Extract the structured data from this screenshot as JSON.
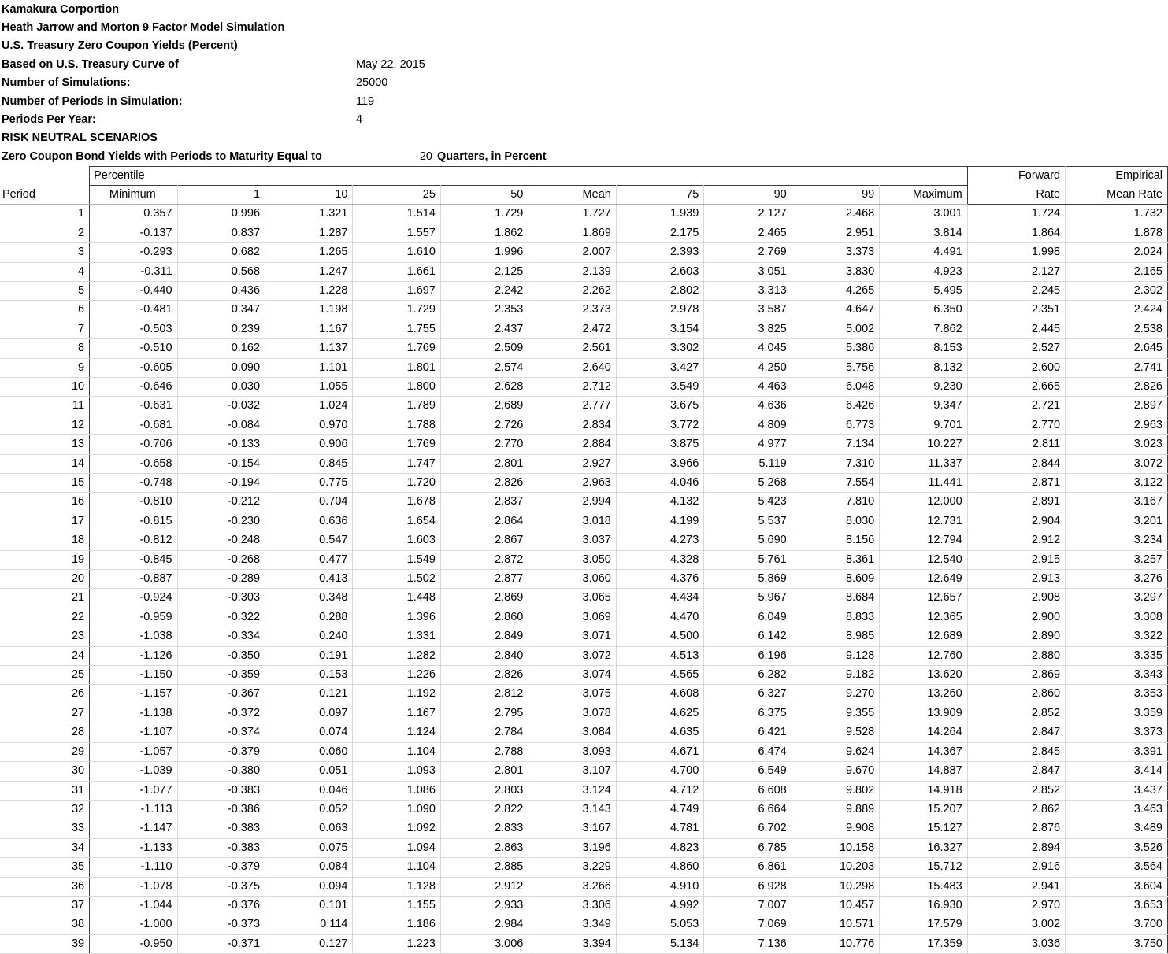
{
  "header": {
    "company": "Kamakura Corportion",
    "model": "Heath Jarrow and Morton 9 Factor Model Simulation",
    "subject": "U.S. Treasury Zero Coupon Yields (Percent)",
    "rows": [
      {
        "label": "Based on U.S. Treasury Curve of",
        "value": "May 22, 2015"
      },
      {
        "label": "Number of Simulations:",
        "value": "25000"
      },
      {
        "label": "Number of Periods in Simulation:",
        "value": "119"
      },
      {
        "label": "Periods Per Year:",
        "value": "4"
      }
    ],
    "scenario_label": "RISK NEUTRAL SCENARIOS",
    "maturity_label": "Zero Coupon Bond Yields with Periods to Maturity Equal to",
    "maturity_value": "20",
    "maturity_unit": "Quarters, in Percent"
  },
  "table": {
    "group_header": "Percentile",
    "period_header": "Period",
    "forward_line1": "Forward",
    "forward_line2": "Rate",
    "empirical_line1": "Empirical",
    "empirical_line2": "Mean Rate",
    "columns": [
      "Minimum",
      "1",
      "10",
      "25",
      "50",
      "Mean",
      "75",
      "90",
      "99",
      "Maximum"
    ],
    "rows": [
      [
        "1",
        "0.357",
        "0.996",
        "1.321",
        "1.514",
        "1.729",
        "1.727",
        "1.939",
        "2.127",
        "2.468",
        "3.001",
        "1.724",
        "1.732"
      ],
      [
        "2",
        "-0.137",
        "0.837",
        "1.287",
        "1.557",
        "1.862",
        "1.869",
        "2.175",
        "2.465",
        "2.951",
        "3.814",
        "1.864",
        "1.878"
      ],
      [
        "3",
        "-0.293",
        "0.682",
        "1.265",
        "1.610",
        "1.996",
        "2.007",
        "2.393",
        "2.769",
        "3.373",
        "4.491",
        "1.998",
        "2.024"
      ],
      [
        "4",
        "-0.311",
        "0.568",
        "1.247",
        "1.661",
        "2.125",
        "2.139",
        "2.603",
        "3.051",
        "3.830",
        "4.923",
        "2.127",
        "2.165"
      ],
      [
        "5",
        "-0.440",
        "0.436",
        "1.228",
        "1.697",
        "2.242",
        "2.262",
        "2.802",
        "3.313",
        "4.265",
        "5.495",
        "2.245",
        "2.302"
      ],
      [
        "6",
        "-0.481",
        "0.347",
        "1.198",
        "1.729",
        "2.353",
        "2.373",
        "2.978",
        "3.587",
        "4.647",
        "6.350",
        "2.351",
        "2.424"
      ],
      [
        "7",
        "-0.503",
        "0.239",
        "1.167",
        "1.755",
        "2.437",
        "2.472",
        "3.154",
        "3.825",
        "5.002",
        "7.862",
        "2.445",
        "2.538"
      ],
      [
        "8",
        "-0.510",
        "0.162",
        "1.137",
        "1.769",
        "2.509",
        "2.561",
        "3.302",
        "4.045",
        "5.386",
        "8.153",
        "2.527",
        "2.645"
      ],
      [
        "9",
        "-0.605",
        "0.090",
        "1.101",
        "1.801",
        "2.574",
        "2.640",
        "3.427",
        "4.250",
        "5.756",
        "8.132",
        "2.600",
        "2.741"
      ],
      [
        "10",
        "-0.646",
        "0.030",
        "1.055",
        "1.800",
        "2.628",
        "2.712",
        "3.549",
        "4.463",
        "6.048",
        "9.230",
        "2.665",
        "2.826"
      ],
      [
        "11",
        "-0.631",
        "-0.032",
        "1.024",
        "1.789",
        "2.689",
        "2.777",
        "3.675",
        "4.636",
        "6.426",
        "9.347",
        "2.721",
        "2.897"
      ],
      [
        "12",
        "-0.681",
        "-0.084",
        "0.970",
        "1.788",
        "2.726",
        "2.834",
        "3.772",
        "4.809",
        "6.773",
        "9.701",
        "2.770",
        "2.963"
      ],
      [
        "13",
        "-0.706",
        "-0.133",
        "0.906",
        "1.769",
        "2.770",
        "2.884",
        "3.875",
        "4.977",
        "7.134",
        "10.227",
        "2.811",
        "3.023"
      ],
      [
        "14",
        "-0.658",
        "-0.154",
        "0.845",
        "1.747",
        "2.801",
        "2.927",
        "3.966",
        "5.119",
        "7.310",
        "11.337",
        "2.844",
        "3.072"
      ],
      [
        "15",
        "-0.748",
        "-0.194",
        "0.775",
        "1.720",
        "2.826",
        "2.963",
        "4.046",
        "5.268",
        "7.554",
        "11.441",
        "2.871",
        "3.122"
      ],
      [
        "16",
        "-0.810",
        "-0.212",
        "0.704",
        "1.678",
        "2.837",
        "2.994",
        "4.132",
        "5.423",
        "7.810",
        "12.000",
        "2.891",
        "3.167"
      ],
      [
        "17",
        "-0.815",
        "-0.230",
        "0.636",
        "1.654",
        "2.864",
        "3.018",
        "4.199",
        "5.537",
        "8.030",
        "12.731",
        "2.904",
        "3.201"
      ],
      [
        "18",
        "-0.812",
        "-0.248",
        "0.547",
        "1.603",
        "2.867",
        "3.037",
        "4.273",
        "5.690",
        "8.156",
        "12.794",
        "2.912",
        "3.234"
      ],
      [
        "19",
        "-0.845",
        "-0.268",
        "0.477",
        "1.549",
        "2.872",
        "3.050",
        "4.328",
        "5.761",
        "8.361",
        "12.540",
        "2.915",
        "3.257"
      ],
      [
        "20",
        "-0.887",
        "-0.289",
        "0.413",
        "1.502",
        "2.877",
        "3.060",
        "4.376",
        "5.869",
        "8.609",
        "12.649",
        "2.913",
        "3.276"
      ],
      [
        "21",
        "-0.924",
        "-0.303",
        "0.348",
        "1.448",
        "2.869",
        "3.065",
        "4.434",
        "5.967",
        "8.684",
        "12.657",
        "2.908",
        "3.297"
      ],
      [
        "22",
        "-0.959",
        "-0.322",
        "0.288",
        "1.396",
        "2.860",
        "3.069",
        "4.470",
        "6.049",
        "8.833",
        "12.365",
        "2.900",
        "3.308"
      ],
      [
        "23",
        "-1.038",
        "-0.334",
        "0.240",
        "1.331",
        "2.849",
        "3.071",
        "4.500",
        "6.142",
        "8.985",
        "12.689",
        "2.890",
        "3.322"
      ],
      [
        "24",
        "-1.126",
        "-0.350",
        "0.191",
        "1.282",
        "2.840",
        "3.072",
        "4.513",
        "6.196",
        "9.128",
        "12.760",
        "2.880",
        "3.335"
      ],
      [
        "25",
        "-1.150",
        "-0.359",
        "0.153",
        "1.226",
        "2.826",
        "3.074",
        "4.565",
        "6.282",
        "9.182",
        "13.620",
        "2.869",
        "3.343"
      ],
      [
        "26",
        "-1.157",
        "-0.367",
        "0.121",
        "1.192",
        "2.812",
        "3.075",
        "4.608",
        "6.327",
        "9.270",
        "13.260",
        "2.860",
        "3.353"
      ],
      [
        "27",
        "-1.138",
        "-0.372",
        "0.097",
        "1.167",
        "2.795",
        "3.078",
        "4.625",
        "6.375",
        "9.355",
        "13.909",
        "2.852",
        "3.359"
      ],
      [
        "28",
        "-1.107",
        "-0.374",
        "0.074",
        "1.124",
        "2.784",
        "3.084",
        "4.635",
        "6.421",
        "9.528",
        "14.264",
        "2.847",
        "3.373"
      ],
      [
        "29",
        "-1.057",
        "-0.379",
        "0.060",
        "1.104",
        "2.788",
        "3.093",
        "4.671",
        "6.474",
        "9.624",
        "14.367",
        "2.845",
        "3.391"
      ],
      [
        "30",
        "-1.039",
        "-0.380",
        "0.051",
        "1.093",
        "2.801",
        "3.107",
        "4.700",
        "6.549",
        "9.670",
        "14.887",
        "2.847",
        "3.414"
      ],
      [
        "31",
        "-1.077",
        "-0.383",
        "0.046",
        "1.086",
        "2.803",
        "3.124",
        "4.712",
        "6.608",
        "9.802",
        "14.918",
        "2.852",
        "3.437"
      ],
      [
        "32",
        "-1.113",
        "-0.386",
        "0.052",
        "1.090",
        "2.822",
        "3.143",
        "4.749",
        "6.664",
        "9.889",
        "15.207",
        "2.862",
        "3.463"
      ],
      [
        "33",
        "-1.147",
        "-0.383",
        "0.063",
        "1.092",
        "2.833",
        "3.167",
        "4.781",
        "6.702",
        "9.908",
        "15.127",
        "2.876",
        "3.489"
      ],
      [
        "34",
        "-1.133",
        "-0.383",
        "0.075",
        "1.094",
        "2.863",
        "3.196",
        "4.823",
        "6.785",
        "10.158",
        "16.327",
        "2.894",
        "3.526"
      ],
      [
        "35",
        "-1.110",
        "-0.379",
        "0.084",
        "1.104",
        "2.885",
        "3.229",
        "4.860",
        "6.861",
        "10.203",
        "15.712",
        "2.916",
        "3.564"
      ],
      [
        "36",
        "-1.078",
        "-0.375",
        "0.094",
        "1.128",
        "2.912",
        "3.266",
        "4.910",
        "6.928",
        "10.298",
        "15.483",
        "2.941",
        "3.604"
      ],
      [
        "37",
        "-1.044",
        "-0.376",
        "0.101",
        "1.155",
        "2.933",
        "3.306",
        "4.992",
        "7.007",
        "10.457",
        "16.930",
        "2.970",
        "3.653"
      ],
      [
        "38",
        "-1.000",
        "-0.373",
        "0.114",
        "1.186",
        "2.984",
        "3.349",
        "5.053",
        "7.069",
        "10.571",
        "17.579",
        "3.002",
        "3.700"
      ],
      [
        "39",
        "-0.950",
        "-0.371",
        "0.127",
        "1.223",
        "3.006",
        "3.394",
        "5.134",
        "7.136",
        "10.776",
        "17.359",
        "3.036",
        "3.750"
      ]
    ]
  },
  "colors": {
    "grid_line": "#d9d9d9",
    "border_dark": "#3a3a3a",
    "text": "#000000",
    "background": "#ffffff"
  }
}
